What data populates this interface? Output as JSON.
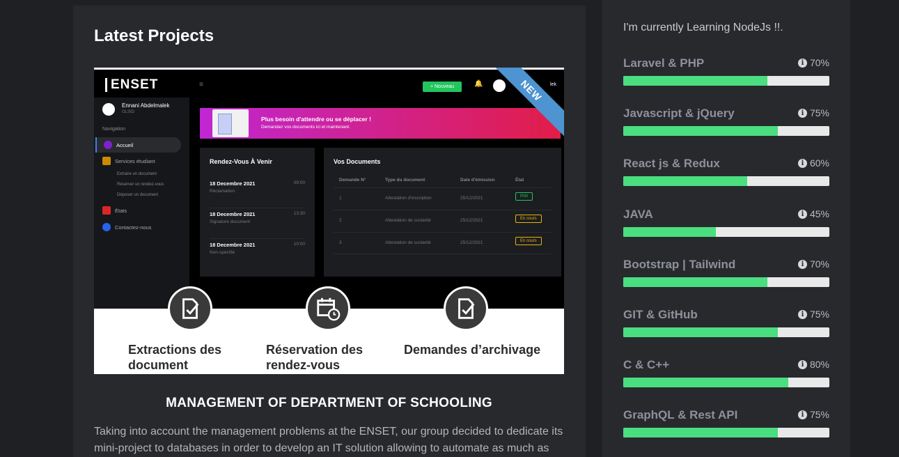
{
  "projects": {
    "title": "Latest Projects",
    "project": {
      "title": "MANAGEMENT OF DEPARTMENT OF SCHOOLING",
      "description": "Taking into account the management problems at the ENSET, our group decided to dedicate its mini-project to databases in order to develop an IT solution allowing to automate as much as",
      "ribbon": "NEW",
      "screenshot": {
        "logo": "ENSET",
        "new_button": "+ Nouveau",
        "user_short": "lek",
        "sidebar": {
          "user_name": "Ennani Abdelmalek",
          "user_sub": "GLSID",
          "nav_label": "Navigation",
          "items": [
            "Accueil",
            "Services étudiant",
            "États",
            "Contactez-nous"
          ],
          "sub_items": [
            "Extraire un document",
            "Réserver un rendez-vous",
            "Déposer un document"
          ]
        },
        "banner": {
          "title": "Plus besoin d'attendre ou se déplacer !",
          "text": "Demandez vos documents ici et maintenant."
        },
        "rdv": {
          "title": "Rendez-Vous À Venir",
          "items": [
            {
              "date": "18 Decembre 2021",
              "desc": "Réclamation",
              "time": "09:00"
            },
            {
              "date": "18 Decembre 2021",
              "desc": "Signature document",
              "time": "13:30"
            },
            {
              "date": "18 Decembre 2021",
              "desc": "Non-spécifié",
              "time": "10:00"
            }
          ]
        },
        "docs": {
          "title": "Vos Documents",
          "headers": [
            "Demande N°",
            "Type du document",
            "Date d'émission",
            "État"
          ],
          "rows": [
            {
              "num": "1",
              "type": "Attestation d'inscription",
              "date": "25/12/2021",
              "status": "Prêt"
            },
            {
              "num": "2",
              "type": "Attestation de scolarité",
              "date": "25/12/2021",
              "status": "En cours"
            },
            {
              "num": "3",
              "type": "Attestation de scolarité",
              "date": "25/12/2021",
              "status": "En cours"
            }
          ]
        },
        "features": [
          {
            "label_line1": "Extractions des",
            "label_line2": "document",
            "icon": "document-check-icon"
          },
          {
            "label_line1": "Réservation des",
            "label_line2": "rendez-vous",
            "icon": "calendar-clock-icon"
          },
          {
            "label_line1": "Demandes d’archivage",
            "label_line2": "",
            "icon": "document-check-icon"
          }
        ]
      }
    }
  },
  "skills": {
    "learning_text": "I'm currently Learning NodeJs !!.",
    "items": [
      {
        "name": "Laravel & PHP",
        "percent_label": "70%",
        "value": 0.7
      },
      {
        "name": "Javascript & jQuery",
        "percent_label": "75%",
        "value": 0.75
      },
      {
        "name": "React js & Redux",
        "percent_label": "60%",
        "value": 0.6
      },
      {
        "name": "JAVA",
        "percent_label": "45%",
        "value": 0.45
      },
      {
        "name": "Bootstrap | Tailwind",
        "percent_label": "70%",
        "value": 0.7
      },
      {
        "name": "GIT & GitHub",
        "percent_label": "75%",
        "value": 0.75
      },
      {
        "name": "C & C++",
        "percent_label": "80%",
        "value": 0.8
      },
      {
        "name": "GraphQL & Rest API",
        "percent_label": "75%",
        "value": 0.75
      }
    ],
    "bar_color": "#4ade80",
    "track_color": "#e9e9e9"
  }
}
